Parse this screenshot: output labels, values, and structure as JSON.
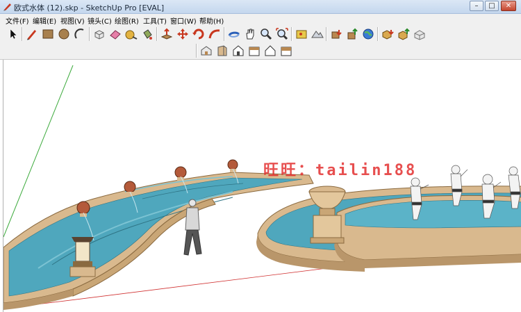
{
  "window": {
    "title": "欧式水体 (12).skp - SketchUp Pro [EVAL]",
    "minimize_label": "–",
    "maximize_label": "□",
    "close_label": "✕"
  },
  "menu": [
    {
      "label": "文件(F)"
    },
    {
      "label": "编辑(E)"
    },
    {
      "label": "视图(V)"
    },
    {
      "label": "镜头(C)"
    },
    {
      "label": "绘图(R)"
    },
    {
      "label": "工具(T)"
    },
    {
      "label": "窗口(W)"
    },
    {
      "label": "帮助(H)"
    }
  ],
  "toolbar_main": [
    "select-icon",
    "pencil-icon",
    "rectangle-icon",
    "circle-icon",
    "arc-icon",
    "make-component-icon",
    "eraser-icon",
    "tape-measure-icon",
    "paint-bucket-icon",
    "push-pull-icon",
    "move-icon",
    "rotate-icon",
    "follow-me-icon",
    "orbit-icon",
    "pan-icon",
    "zoom-icon",
    "zoom-extents-icon",
    "add-location-icon",
    "toggle-terrain-icon",
    "get-models-icon",
    "share-model-icon",
    "3d-warehouse-icon",
    "google-earth-icon",
    "get-components-icon",
    "share-component-icon",
    "extension-warehouse-icon"
  ],
  "toolbar_views": [
    "iso-view-icon",
    "top-view-icon",
    "front-view-icon",
    "right-view-icon",
    "back-view-icon",
    "left-view-icon"
  ],
  "watermark": "旺旺：tailin188",
  "colors": {
    "titlebar": "#c4d7ee",
    "water": "#4fa7bd",
    "stone": "#d9b98e",
    "stone_dark": "#b9966a"
  }
}
